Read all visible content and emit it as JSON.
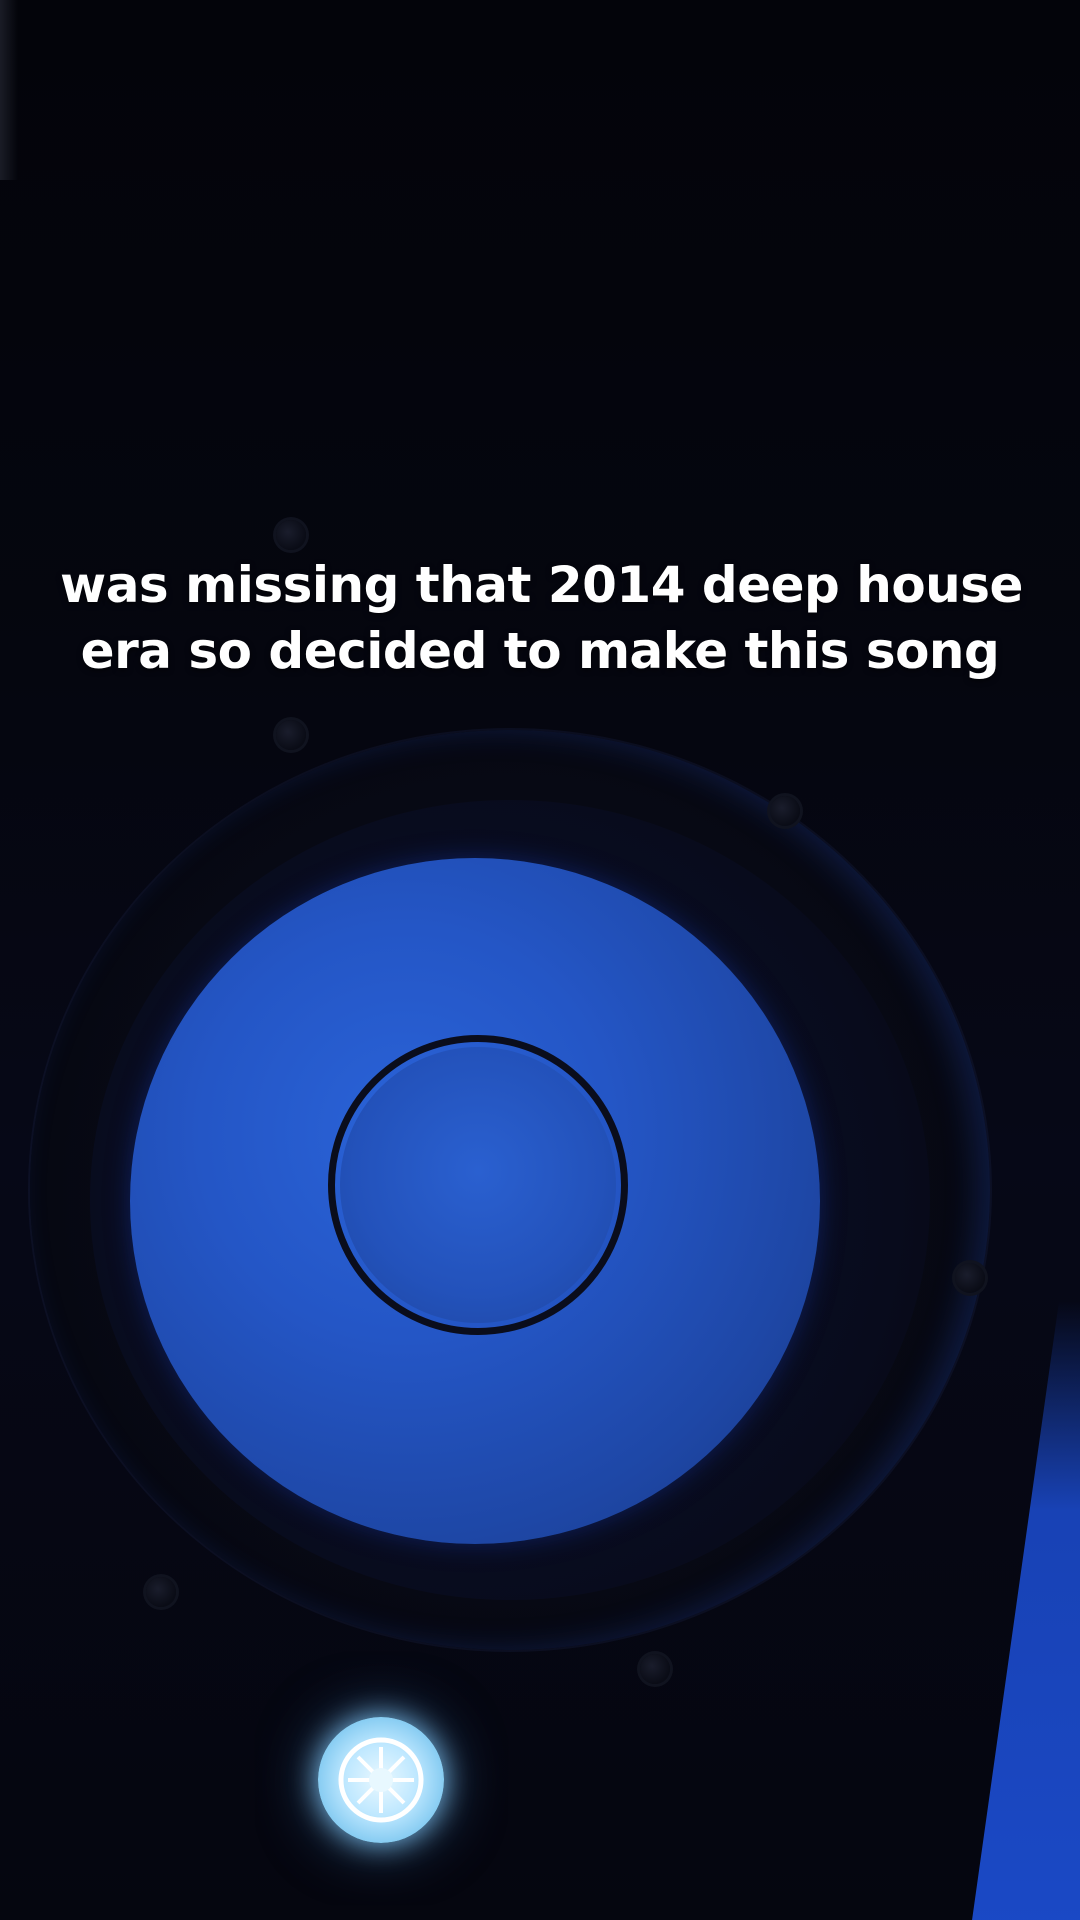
{
  "caption": {
    "line1": "was missing that 2014 deep house",
    "line2": "era so decided to make this song"
  },
  "scene": {
    "subject": "speaker-woofer",
    "badge_icon": "speaker-logo-icon",
    "colors": {
      "cone": "#2456c6",
      "background": "#04050d",
      "badge_glow": "#bfe8ff",
      "edge_glow": "#1b4ac8"
    }
  }
}
